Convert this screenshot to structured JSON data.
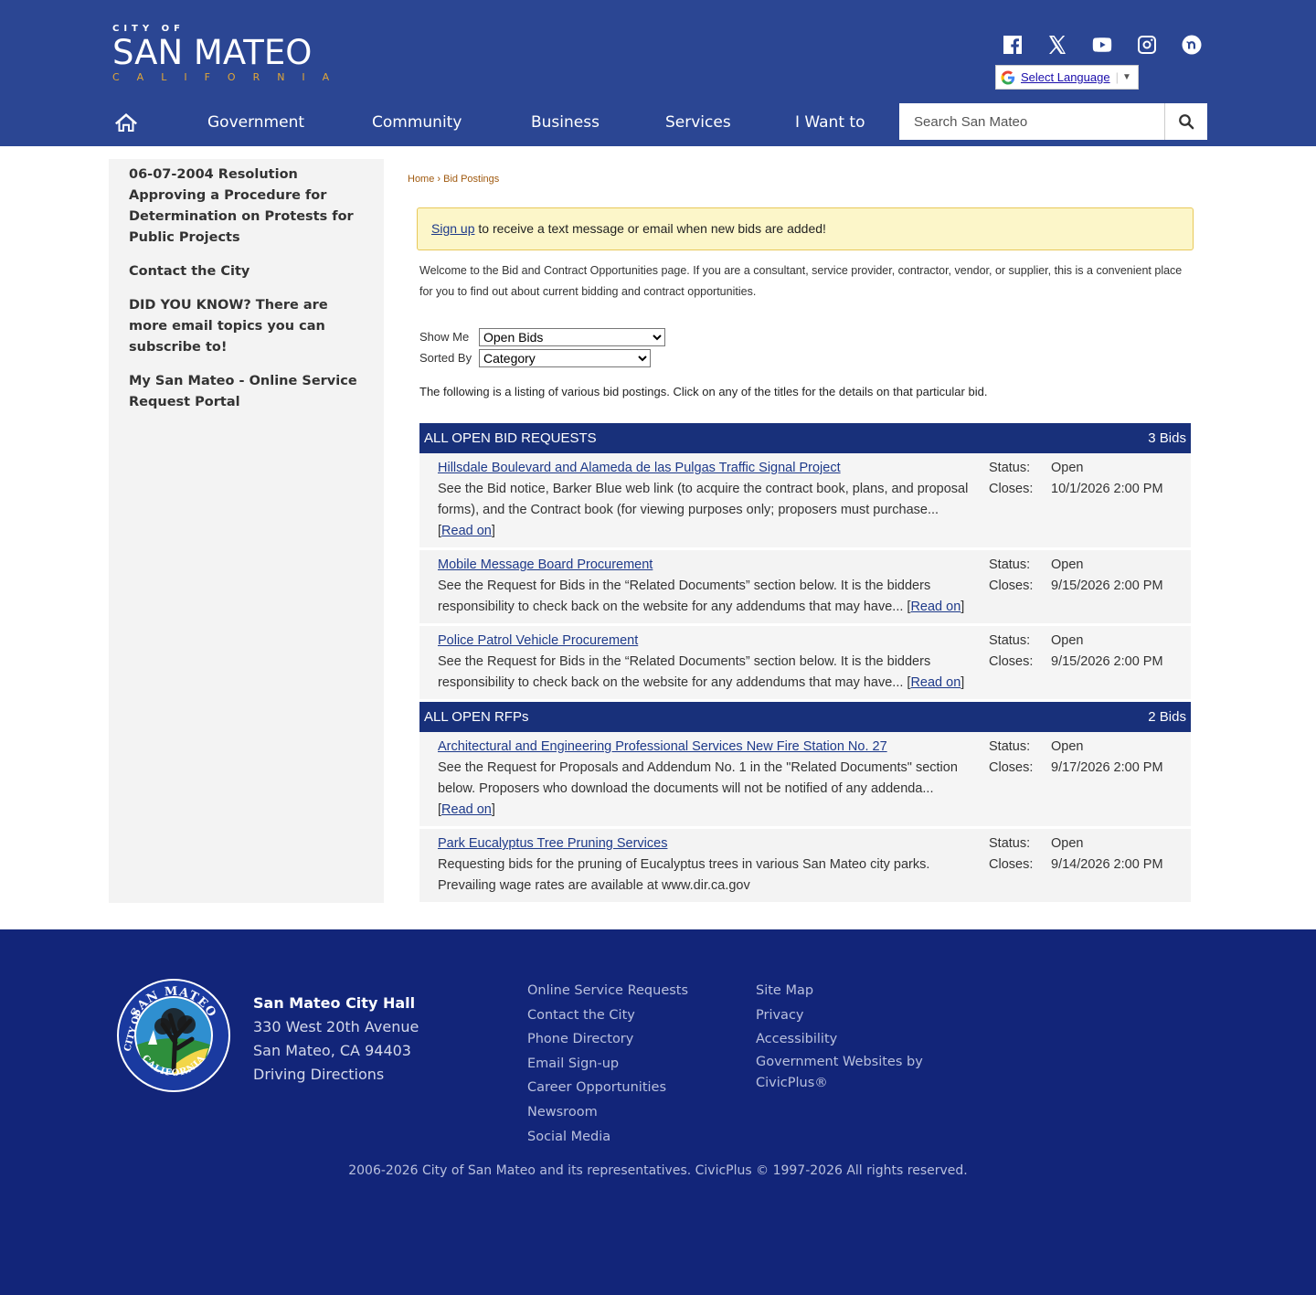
{
  "header": {
    "logo_top": "CITY OF",
    "logo_main": "SAN MATEO",
    "logo_bottom": "CALIFORNIA",
    "social_icons": [
      "facebook-icon",
      "x-icon",
      "youtube-icon",
      "instagram-icon",
      "nextdoor-icon"
    ],
    "language_label": "Select Language",
    "nav": [
      "Government",
      "Community",
      "Business",
      "Services",
      "I Want to"
    ],
    "search_placeholder": "Search San Mateo"
  },
  "sidebar": {
    "items": [
      "06-07-2004 Resolution Approving a Procedure for Determination on Protests for Public Projects",
      "Contact the City",
      "DID YOU KNOW? There are more email topics you can subscribe to!",
      "My San Mateo - Online Service Request Portal"
    ]
  },
  "main": {
    "breadcrumb_home": "Home",
    "breadcrumb_sep": "›",
    "breadcrumb_current": "Bid Postings",
    "alert_link": "Sign up",
    "alert_text": " to receive a text message or email when new bids are added!",
    "intro": "Welcome to the Bid and Contract Opportunities page. If you are a consultant, service provider, contractor, vendor, or supplier, this is a convenient place for you to find out about current bidding and contract opportunities.",
    "show_me_label": "Show Me",
    "show_me_value": "Open Bids",
    "sorted_by_label": "Sorted By",
    "sorted_by_value": "Category",
    "listing_text": "The following is a listing of various bid postings. Click on any of the titles for the details on that particular bid.",
    "status_label": "Status:",
    "closes_label": "Closes:",
    "read_on": "Read on",
    "categories": [
      {
        "title": "ALL OPEN BID REQUESTS",
        "count": "3 Bids",
        "bids": [
          {
            "title": "Hillsdale Boulevard and Alameda de las Pulgas Traffic Signal Project",
            "desc": "See the Bid notice, Barker Blue web link (to acquire the contract book, plans, and proposal forms), and the Contract book (for viewing purposes only; proposers must purchase...",
            "status": "Open",
            "closes": "10/1/2026 2:00 PM"
          },
          {
            "title": "Mobile Message Board Procurement",
            "desc": "See the Request for Bids in the “Related Documents” section below. It is the bidders responsibility to check back on the website for any addendums that may have...",
            "status": "Open",
            "closes": "9/15/2026 2:00 PM"
          },
          {
            "title": "Police Patrol Vehicle Procurement",
            "desc": "See the Request for Bids in the “Related Documents” section below. It is the bidders responsibility to check back on the website for any addendums that may have...",
            "status": "Open",
            "closes": "9/15/2026 2:00 PM"
          }
        ]
      },
      {
        "title": "ALL OPEN RFPs",
        "count": "2 Bids",
        "bids": [
          {
            "title": "Architectural and Engineering Professional Services New Fire Station No. 27",
            "desc": "See the Request for Proposals and Addendum No. 1 in the \"Related Documents\" section below. Proposers who download the documents will not be notified of any addenda...",
            "status": "Open",
            "closes": "9/17/2026 2:00 PM"
          },
          {
            "title": "Park Eucalyptus Tree Pruning Services",
            "desc": "Requesting bids for the pruning of Eucalyptus trees in various San Mateo city parks. Prevailing wage rates are available at www.dir.ca.gov",
            "status": "Open",
            "closes": "9/14/2026 2:00 PM"
          }
        ]
      }
    ]
  },
  "footer": {
    "seal_top": "SAN MATEO",
    "seal_left": "CITY OF",
    "seal_bottom": "CALIFORNIA",
    "address_name": "San Mateo City Hall",
    "address_street": "330 West 20th Avenue",
    "address_city": "San Mateo, CA 94403",
    "directions": "Driving Directions",
    "col1": [
      "Online Service Requests",
      "Contact the City",
      "Phone Directory",
      "Email Sign-up",
      "Career Opportunities",
      "Newsroom",
      "Social Media"
    ],
    "col2": [
      "Site Map",
      "Privacy",
      "Accessibility"
    ],
    "gov_websites": "Government Websites by CivicPlus®",
    "copyright": "2006-2026 City of San Mateo and its representatives. CivicPlus © 1997-2026 All rights reserved."
  }
}
